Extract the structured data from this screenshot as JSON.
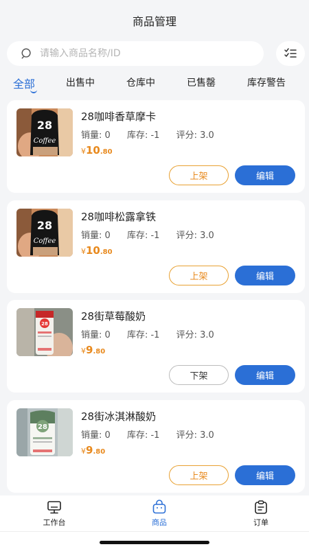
{
  "header": {
    "title": "商品管理"
  },
  "search": {
    "placeholder": "请输入商品名称/ID"
  },
  "tabs": [
    {
      "label": "全部",
      "active": true
    },
    {
      "label": "出售中"
    },
    {
      "label": "仓库中"
    },
    {
      "label": "已售罄"
    },
    {
      "label": "库存警告"
    }
  ],
  "products": [
    {
      "name": "28咖啡香草摩卡",
      "sales": "销量: 0",
      "stock": "库存: -1",
      "rating": "评分: 3.0",
      "price_symbol": "¥",
      "price_int": "10",
      "price_dec": ".80",
      "shelf_label": "上架",
      "edit_label": "编辑",
      "thumb_text": "28",
      "thumb_sub": "Coffee"
    },
    {
      "name": "28咖啡松露拿铁",
      "sales": "销量: 0",
      "stock": "库存: -1",
      "rating": "评分: 3.0",
      "price_symbol": "¥",
      "price_int": "10",
      "price_dec": ".80",
      "shelf_label": "上架",
      "edit_label": "编辑",
      "thumb_text": "28",
      "thumb_sub": "Coffee"
    },
    {
      "name": "28街草莓酸奶",
      "sales": "销量: 0",
      "stock": "库存: -1",
      "rating": "评分: 3.0",
      "price_symbol": "¥",
      "price_int": "9",
      "price_dec": ".80",
      "shelf_label": "下架",
      "edit_label": "编辑",
      "thumb_text": "28",
      "thumb_sub": ""
    },
    {
      "name": "28街冰淇淋酸奶",
      "sales": "销量: 0",
      "stock": "库存: -1",
      "rating": "评分: 3.0",
      "price_symbol": "¥",
      "price_int": "9",
      "price_dec": ".80",
      "shelf_label": "上架",
      "edit_label": "编辑",
      "thumb_text": "28",
      "thumb_sub": ""
    }
  ],
  "nav": [
    {
      "label": "工作台",
      "icon": "monitor-icon"
    },
    {
      "label": "商品",
      "icon": "bag-icon",
      "active": true
    },
    {
      "label": "订单",
      "icon": "clipboard-icon"
    }
  ],
  "colors": {
    "accent": "#2b6fd6",
    "price": "#e8891d",
    "background": "#f4f5f7"
  }
}
